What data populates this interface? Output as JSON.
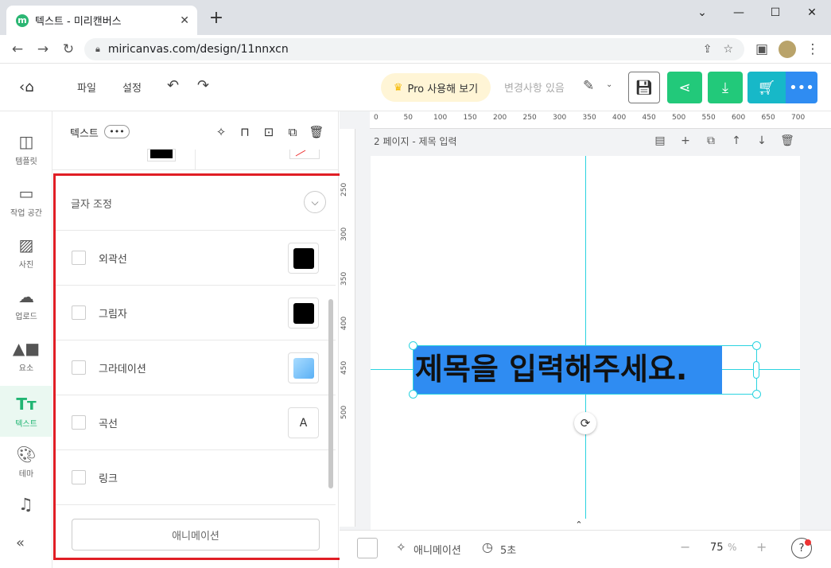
{
  "browser": {
    "tab_title": "텍스트 - 미리캔버스",
    "favicon": "m",
    "new_tab": "+",
    "url": "miricanvas.com/design/11nnxcn"
  },
  "header": {
    "menu_file": "파일",
    "menu_settings": "설정",
    "pro_label": "Pro 사용해 보기",
    "changes": "변경사항 있음",
    "colors": {
      "share": "#22c97a",
      "download": "#22c97a",
      "cart": "#17b8c8",
      "more": "#2f8cf2"
    }
  },
  "nav": {
    "items": [
      {
        "label": "템플릿"
      },
      {
        "label": "작업 공간"
      },
      {
        "label": "사진"
      },
      {
        "label": "업로드"
      },
      {
        "label": "요소"
      },
      {
        "label": "텍스트"
      },
      {
        "label": "테마"
      }
    ],
    "collapse": "«"
  },
  "panel": {
    "title": "텍스트",
    "more": "•••",
    "adjust_title": "글자 조정",
    "rows": [
      {
        "label": "외곽선",
        "swatch": "#000000"
      },
      {
        "label": "그림자",
        "swatch": "#000000"
      },
      {
        "label": "그라데이션",
        "swatch": "#7cc4fa"
      },
      {
        "label": "곡선",
        "icon": "A"
      },
      {
        "label": "링크"
      }
    ],
    "animation_button": "애니메이션"
  },
  "canvas": {
    "ruler_top": [
      "0",
      "50",
      "100",
      "150",
      "200",
      "250",
      "300",
      "350",
      "400",
      "450",
      "500",
      "550",
      "600",
      "650",
      "700"
    ],
    "ruler_left": [
      "250",
      "300",
      "350",
      "400",
      "450",
      "500"
    ],
    "page_label": "2 페이지 - 제목 입력",
    "text": "제목을 입력해주세요."
  },
  "bottom": {
    "animation": "애니메이션",
    "duration": "5초",
    "zoom_minus": "−",
    "zoom_value": "75",
    "zoom_unit": "%",
    "zoom_plus": "+",
    "help": "?"
  }
}
